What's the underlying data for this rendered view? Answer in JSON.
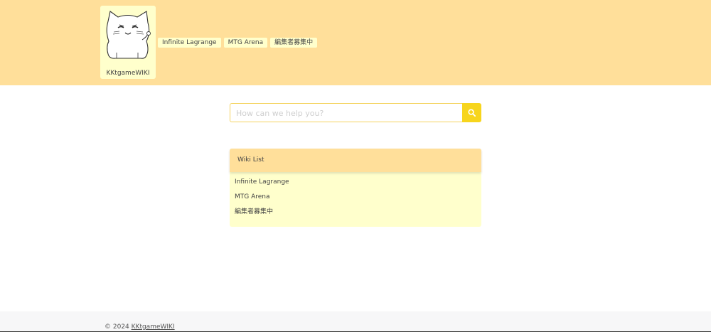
{
  "header": {
    "logo_text": "KKtgameWIKI",
    "nav": [
      {
        "label": "Infinite Lagrange"
      },
      {
        "label": "MTG Arena"
      },
      {
        "label": "編集者募集中"
      }
    ]
  },
  "search": {
    "placeholder": "How can we help you?",
    "button_icon": "search-icon"
  },
  "wiki_list": {
    "title": "Wiki List",
    "items": [
      {
        "label": "Infinite Lagrange"
      },
      {
        "label": "MTG Arena"
      },
      {
        "label": "編集者募集中"
      }
    ]
  },
  "footer": {
    "copyright": "© 2024",
    "site_link": "KKtgameWIKI"
  },
  "colors": {
    "header_bg": "#ffdf9a",
    "card_bg": "#ffffcc",
    "search_button": "#f7d51d"
  }
}
